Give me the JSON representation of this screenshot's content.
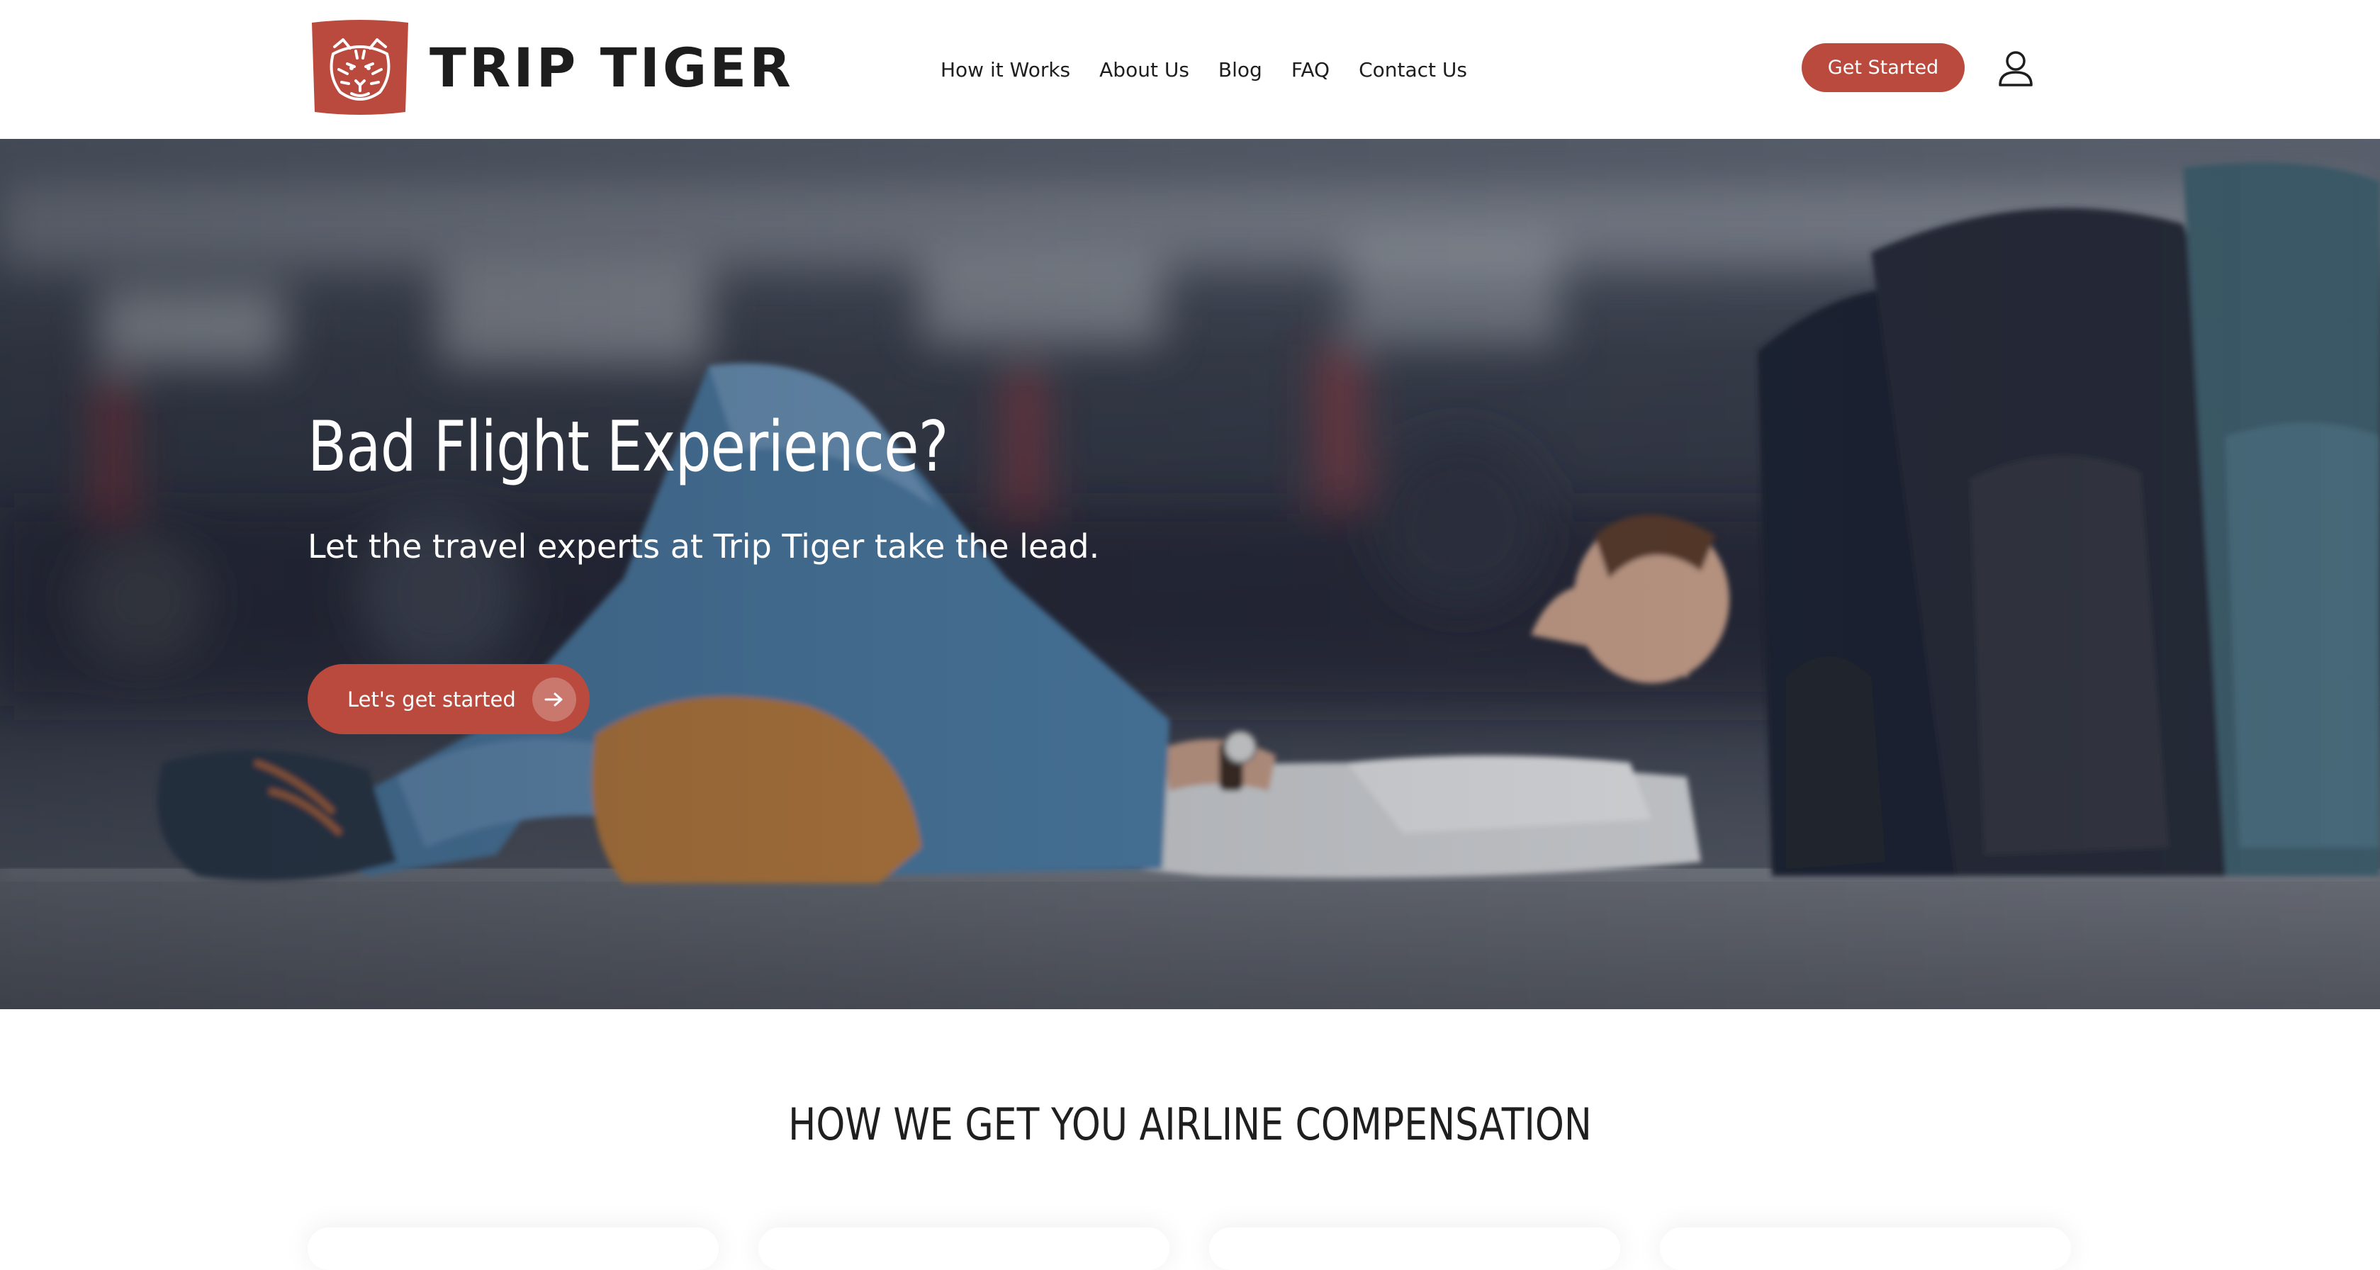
{
  "header": {
    "brand_name": "TRIP TIGER",
    "nav": [
      {
        "label": "How it Works"
      },
      {
        "label": "About Us"
      },
      {
        "label": "Blog"
      },
      {
        "label": "FAQ"
      },
      {
        "label": "Contact Us"
      }
    ],
    "cta_label": "Get Started",
    "account_icon": "user-icon"
  },
  "hero": {
    "title": "Bad Flight Experience?",
    "subtitle": "Let the travel experts at Trip Tiger take the lead.",
    "button_label": "Let's get started",
    "button_icon": "arrow-right-icon"
  },
  "section": {
    "title": "HOW WE GET YOU AIRLINE COMPENSATION"
  },
  "colors": {
    "brand": "#b94a3d",
    "text_dark": "#1e1e1e",
    "white": "#ffffff"
  }
}
